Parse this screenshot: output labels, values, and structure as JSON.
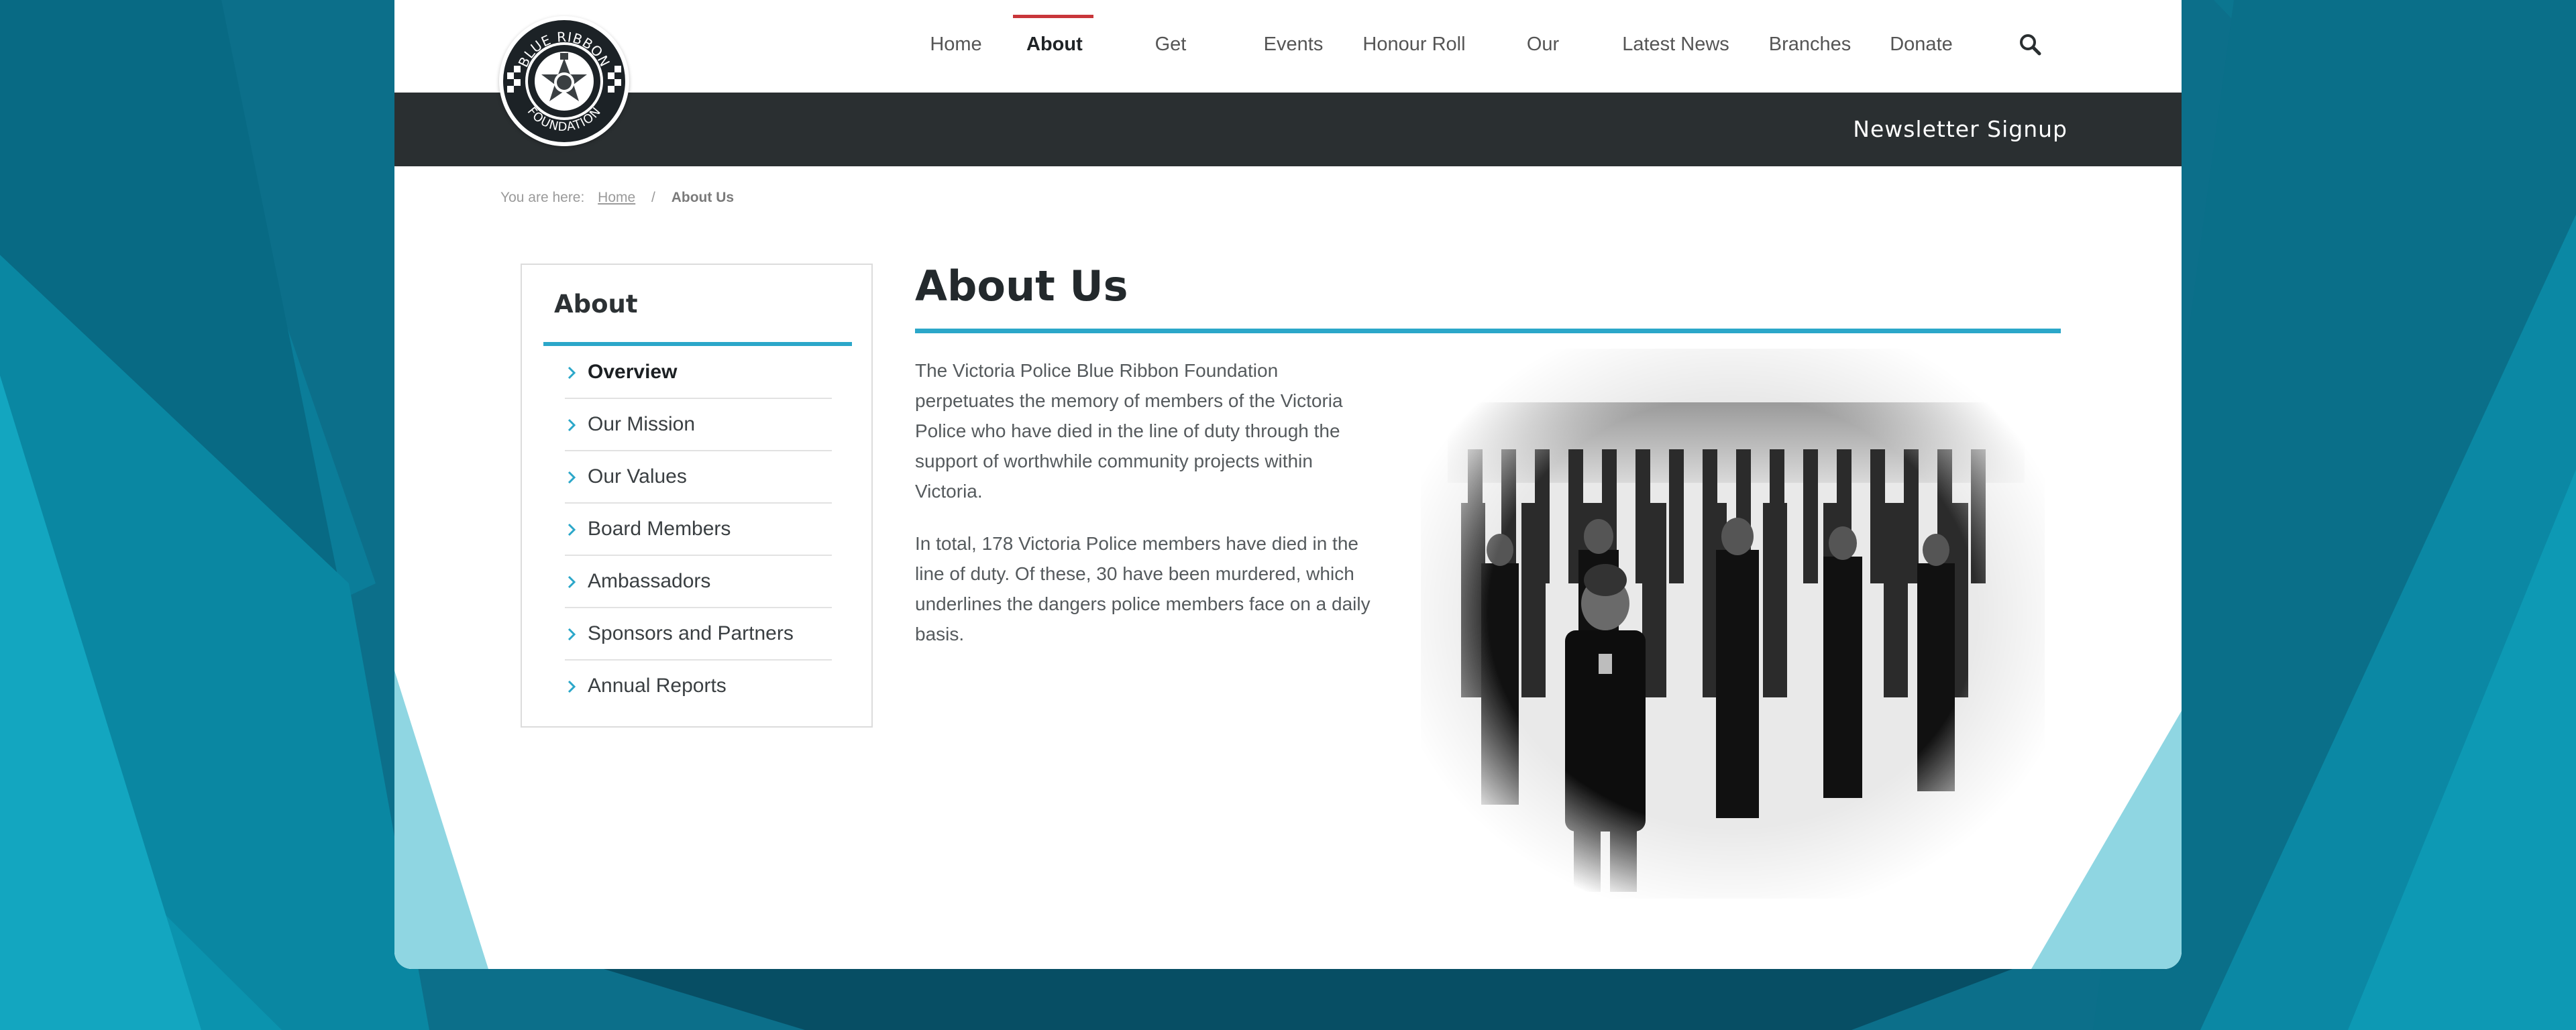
{
  "header": {
    "logo": {
      "top_text": "BLUE RIBBON",
      "bottom_text": "FOUNDATION",
      "icon": "police-badge-icon"
    },
    "nav": [
      {
        "label": "Home",
        "active": false
      },
      {
        "label": "About",
        "active": true
      },
      {
        "label": "Get Involved",
        "active": false
      },
      {
        "label": "Events",
        "active": false
      },
      {
        "label": "Honour Roll",
        "active": false
      },
      {
        "label": "Our Work",
        "active": false
      },
      {
        "label": "Latest News",
        "active": false
      },
      {
        "label": "Branches",
        "active": false
      },
      {
        "label": "Donate",
        "active": false
      }
    ],
    "search_icon": "search-icon",
    "newsletter_label": "Newsletter Signup"
  },
  "breadcrumb": {
    "prefix": "You are here:",
    "home": "Home",
    "separator": "/",
    "current": "About Us"
  },
  "sidebar": {
    "title": "About",
    "items": [
      {
        "label": "Overview",
        "active": true
      },
      {
        "label": "Our Mission",
        "active": false
      },
      {
        "label": "Our Values",
        "active": false
      },
      {
        "label": "Board Members",
        "active": false
      },
      {
        "label": "Ambassadors",
        "active": false
      },
      {
        "label": "Sponsors and Partners",
        "active": false
      },
      {
        "label": "Annual Reports",
        "active": false
      }
    ],
    "chevron_icon": "chevron-right-icon"
  },
  "main": {
    "title": "About Us",
    "paragraphs": [
      "The Victoria Police Blue Ribbon Foundation perpetuates the memory of members of the Victoria Police who have died in the line of duty through the support of worthwhile community projects within Victoria.",
      "In total, 178 Victoria Police members have died in the line of duty. Of these, 30 have been murdered, which underlines the dangers police members face on a daily basis."
    ]
  },
  "colors": {
    "accent": "#2ba7c9",
    "nav_active_bar": "#c8363a",
    "navbar_bg": "#2a2f31",
    "background_teal": "#0a5f78"
  }
}
